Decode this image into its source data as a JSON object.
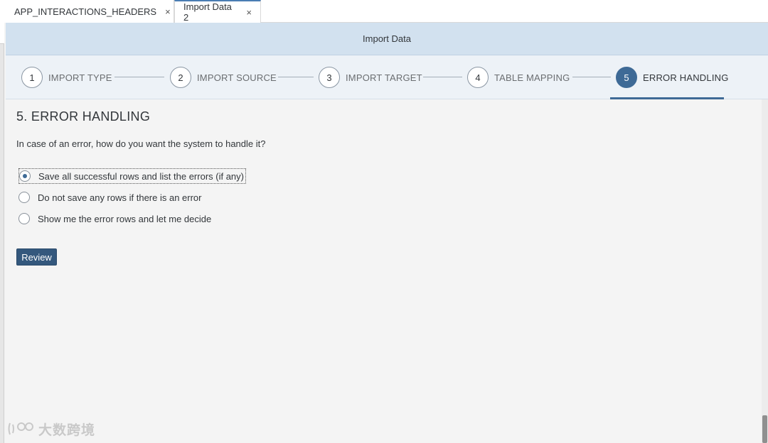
{
  "tabs": [
    {
      "label": "APP_INTERACTIONS_HEADERS",
      "close": "×"
    },
    {
      "label": "Import Data 2",
      "close": "×"
    }
  ],
  "dialog": {
    "title": "Import Data"
  },
  "steps": [
    {
      "number": "1",
      "label": "IMPORT TYPE"
    },
    {
      "number": "2",
      "label": "IMPORT SOURCE"
    },
    {
      "number": "3",
      "label": "IMPORT TARGET"
    },
    {
      "number": "4",
      "label": "TABLE MAPPING"
    },
    {
      "number": "5",
      "label": "ERROR HANDLING"
    }
  ],
  "current_step": 5,
  "section": {
    "title": "5. ERROR HANDLING",
    "question": "In case of an error, how do you want the system to handle it?",
    "options": [
      {
        "label": "Save all successful rows and list the errors (if any)",
        "selected": true
      },
      {
        "label": "Do not save any rows if there is an error",
        "selected": false
      },
      {
        "label": "Show me the error rows and let me decide",
        "selected": false
      }
    ],
    "review_label": "Review"
  },
  "watermark": {
    "text": "大数跨境"
  },
  "colors": {
    "accent": "#3e6a96",
    "header_bg": "#d2e1ef",
    "stepper_bg": "#edf2f7",
    "button_bg": "#34587d"
  }
}
